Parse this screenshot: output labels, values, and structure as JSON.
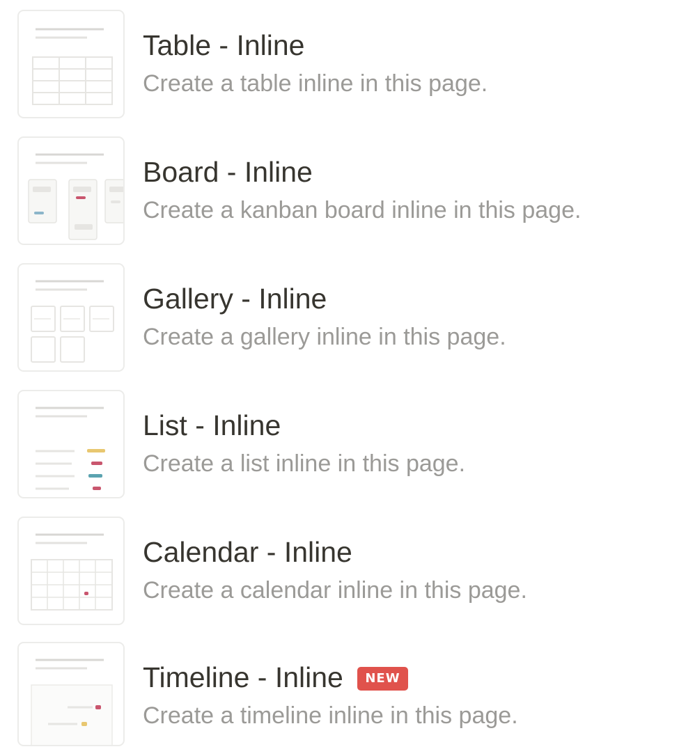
{
  "items": [
    {
      "title": "Table - Inline",
      "description": "Create a table inline in this page.",
      "thumbnail_icon": "table-view-icon"
    },
    {
      "title": "Board - Inline",
      "description": "Create a kanban board inline in this page.",
      "thumbnail_icon": "board-view-icon"
    },
    {
      "title": "Gallery - Inline",
      "description": "Create a gallery inline in this page.",
      "thumbnail_icon": "gallery-view-icon"
    },
    {
      "title": "List - Inline",
      "description": "Create a list inline in this page.",
      "thumbnail_icon": "list-view-icon"
    },
    {
      "title": "Calendar - Inline",
      "description": "Create a calendar inline in this page.",
      "thumbnail_icon": "calendar-view-icon"
    },
    {
      "title": "Timeline - Inline",
      "description": "Create a timeline inline in this page.",
      "thumbnail_icon": "timeline-view-icon",
      "badge": "NEW"
    }
  ],
  "colors": {
    "title_text": "#37352f",
    "description_text": "#9b9a97",
    "badge_background": "#e0524c",
    "thumbnail_border": "#ececea"
  }
}
